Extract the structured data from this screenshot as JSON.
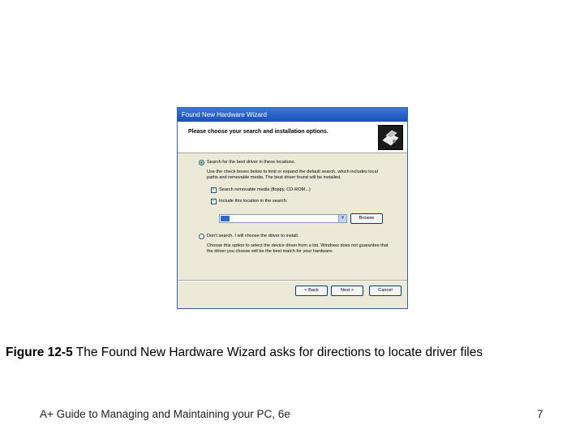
{
  "window": {
    "title": "Found New Hardware Wizard",
    "header_text": "Please choose your search and installation options.",
    "icon": "hardware-wizard-icon"
  },
  "options": {
    "search_label": "Search for the best driver in these locations.",
    "search_selected": true,
    "search_desc_line1": "Use the check boxes below to limit or expand the default search, which includes local",
    "search_desc_line2": "paths and removable media. The best driver found will be installed.",
    "removable_label": "Search removable media (floppy, CD-ROM...)",
    "removable_checked": true,
    "location_label": "Include this location in the search:",
    "location_checked": true,
    "location_value": "",
    "browse_label": "Browse",
    "dont_search_label": "Don't search. I will choose the driver to install.",
    "dont_search_selected": false,
    "dont_desc_line1": "Choose this option to select the device driver from a list. Windows does not guarantee that",
    "dont_desc_line2": "the driver you choose will be the best match for your hardware."
  },
  "buttons": {
    "back": "< Back",
    "next": "Next >",
    "cancel": "Cancel"
  },
  "caption": {
    "figure_label": "Figure 12-5",
    "text": " The Found New Hardware Wizard asks for directions to locate driver files"
  },
  "footer": {
    "book": "A+ Guide to Managing and Maintaining your PC, 6e",
    "page": "7"
  }
}
